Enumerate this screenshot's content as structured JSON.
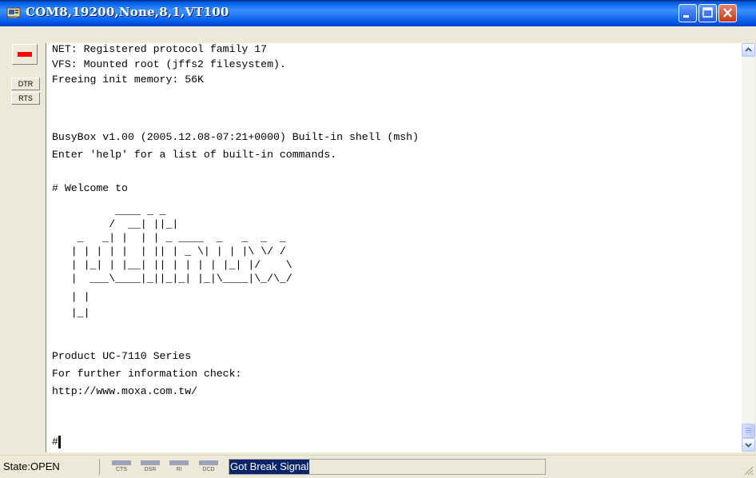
{
  "window": {
    "title": "COM8,19200,None,8,1,VT100"
  },
  "side_panel": {
    "dtr_label": "DTR",
    "rts_label": "RTS"
  },
  "terminal": {
    "lines": [
      "NET: Registered protocol family 17",
      "VFS: Mounted root (jffs2 filesystem).",
      "Freeing init memory: 56K",
      "",
      "",
      "BusyBox v1.00 (2005.12.08-07:21+0000) Built-in shell (msh)",
      "Enter 'help' for a list of built-in commands.",
      "",
      "# Welcome to",
      "",
      "          ____ _ _",
      "         /  __| ||_|",
      "    _   _| |  | | _ ____  _   _  _  _",
      "   | | | | |  | || | _ \\| | | |\\ \\/ /",
      "   | |_| | |__| || | | | | |_| |/    \\",
      "   |  ___\\____|_||_|_| |_|\\____|\\_/\\_/",
      "   | |",
      "   |_|",
      "",
      "Product UC-7110 Series",
      "For further information check:",
      "http://www.moxa.com.tw/",
      "",
      "",
      "#"
    ]
  },
  "status_bar": {
    "state": "State:OPEN",
    "leds": [
      "CTS",
      "DSR",
      "RI",
      "DCD"
    ],
    "message": "Got Break Signal"
  },
  "colors": {
    "titlebar": "#0058e6",
    "break_indicator": "#ff0000",
    "message_highlight": "#0a246a"
  }
}
